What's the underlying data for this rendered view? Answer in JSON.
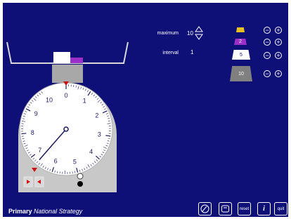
{
  "controls": {
    "maximum_label": "maximum",
    "maximum_value": "10",
    "interval_label": "interval",
    "interval_value": "1"
  },
  "weights": [
    {
      "label": "",
      "color": "#e8c020"
    },
    {
      "label": "2",
      "color": "#9a30c8"
    },
    {
      "label": "5",
      "color": "#ffffff"
    },
    {
      "label": "10",
      "color": "#808080"
    }
  ],
  "dial": {
    "major_labels": [
      "0",
      "1",
      "2",
      "3",
      "4",
      "5",
      "6",
      "7",
      "8",
      "9",
      "10"
    ],
    "maximum": 10,
    "reading": 6.7
  },
  "toolbar": {
    "reset_label": "reset",
    "info_label": "i",
    "quit_label": "quit"
  },
  "footer": {
    "brand_bold": "Primary",
    "brand_italic": "National Strategy"
  },
  "colors": {
    "background": "#0f0f78",
    "scale_body": "#c8c8c8",
    "needle": "#1a1a60",
    "pointer": "#d01010"
  }
}
